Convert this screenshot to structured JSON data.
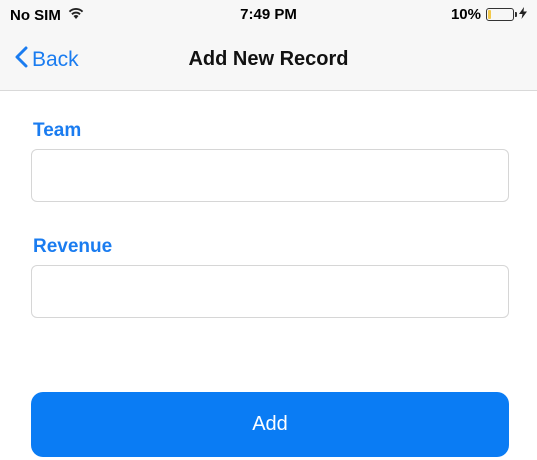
{
  "status_bar": {
    "carrier": "No SIM",
    "time": "7:49 PM",
    "battery": "10%",
    "battery_fill_color": "#f2c94c",
    "icons": [
      "wifi-icon",
      "battery-icon",
      "charging-icon"
    ]
  },
  "nav": {
    "back_label": "Back",
    "title": "Add New Record",
    "accent_color": "#1a7cf0"
  },
  "form": {
    "team_label": "Team",
    "team_value": "",
    "revenue_label": "Revenue",
    "revenue_value": "",
    "add_button_label": "Add",
    "button_color": "#0a7cf4"
  }
}
